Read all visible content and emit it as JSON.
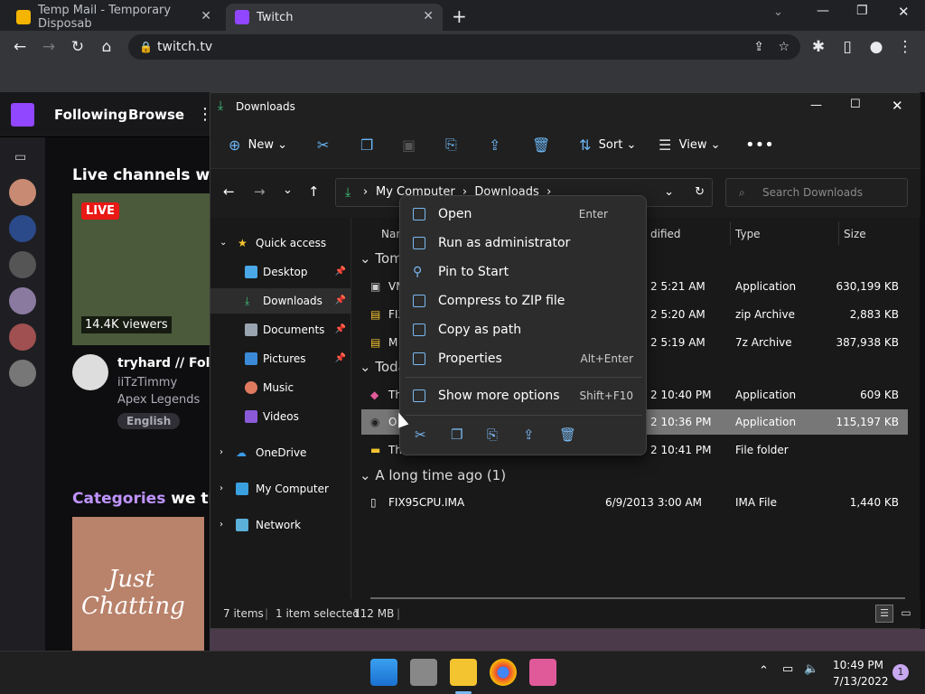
{
  "chrome": {
    "tabs": [
      {
        "title": "Temp Mail - Temporary Disposab",
        "favicon": "envelope-icon"
      },
      {
        "title": "Twitch",
        "favicon": "twitch-icon"
      }
    ],
    "url": "twitch.tv"
  },
  "twitch": {
    "nav": [
      "Following",
      "Browse"
    ],
    "section_title": "Live channels we t",
    "live_badge": "LIVE",
    "viewers": "14.4K viewers",
    "channel_title": "tryhard // Follo",
    "streamer": "iiTzTimmy",
    "game": "Apex Legends",
    "tag": "English",
    "categories_title_1": "Categories",
    "categories_title_2": "we thi",
    "category_art_line1": "Just",
    "category_art_line2": "Chatting"
  },
  "explorer": {
    "title": "Downloads",
    "toolbar": {
      "new": "New",
      "sort": "Sort",
      "view": "View"
    },
    "breadcrumb": [
      "My Computer",
      "Downloads"
    ],
    "search_placeholder": "Search Downloads",
    "nav_pane": {
      "quick_access": "Quick access",
      "items": [
        "Desktop",
        "Downloads",
        "Documents",
        "Pictures",
        "Music",
        "Videos"
      ],
      "roots": [
        "OneDrive",
        "My Computer",
        "Network"
      ]
    },
    "columns": {
      "name": "Nam",
      "modified": "dified",
      "type": "Type",
      "size": "Size"
    },
    "groups": [
      "Tom",
      "Toda",
      "A long time ago (1)"
    ],
    "rows": [
      {
        "name": "VM",
        "date": "2 5:21 AM",
        "type": "Application",
        "size": "630,199 KB"
      },
      {
        "name": "FIX",
        "date": "2 5:20 AM",
        "type": "zip Archive",
        "size": "2,883 KB"
      },
      {
        "name": "M",
        "date": "2 5:19 AM",
        "type": "7z Archive",
        "size": "387,938 KB"
      },
      {
        "name": "Th",
        "date": "2 10:40 PM",
        "type": "Application",
        "size": "609 KB"
      },
      {
        "name": "O",
        "date": "2 10:36 PM",
        "type": "Application",
        "size": "115,197 KB"
      },
      {
        "name": "Th",
        "date": "2 10:41 PM",
        "type": "File folder",
        "size": ""
      },
      {
        "name": "FIX95CPU.IMA",
        "date": "6/9/2013 3:00 AM",
        "type": "IMA File",
        "size": "1,440 KB"
      }
    ],
    "status": {
      "items": "7 items",
      "selected": "1 item selected",
      "size": "112 MB"
    }
  },
  "context_menu": {
    "items": [
      {
        "label": "Open",
        "shortcut": "Enter"
      },
      {
        "label": "Run as administrator",
        "shortcut": ""
      },
      {
        "label": "Pin to Start",
        "shortcut": ""
      },
      {
        "label": "Compress to ZIP file",
        "shortcut": ""
      },
      {
        "label": "Copy as path",
        "shortcut": ""
      },
      {
        "label": "Properties",
        "shortcut": "Alt+Enter"
      },
      {
        "label": "Show more options",
        "shortcut": "Shift+F10"
      }
    ]
  },
  "taskbar": {
    "time": "10:49 PM",
    "date": "7/13/2022",
    "notifications": "1"
  }
}
